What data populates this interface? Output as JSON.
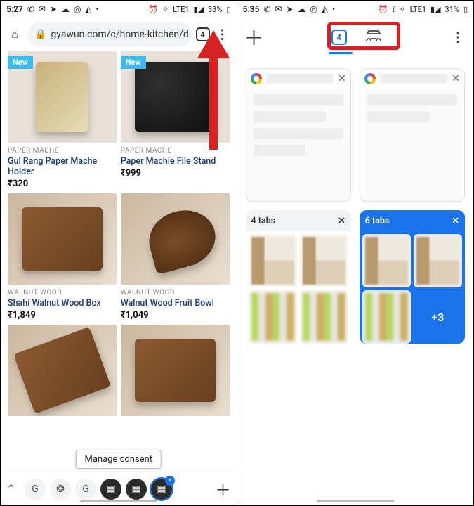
{
  "left": {
    "status": {
      "time": "5:27",
      "battery": "33%",
      "net": "LTE1"
    },
    "url": "gyawun.com/c/home-kitchen/d",
    "tab_count": "4",
    "new_label": "New",
    "products": [
      {
        "cat": "PAPER MACHE",
        "title": "Gul Rang Paper Mache Holder",
        "price": "₹320"
      },
      {
        "cat": "PAPER MACHE",
        "title": "Paper Machie File Stand",
        "price": "₹999"
      },
      {
        "cat": "WALNUT WOOD",
        "title": "Shahi Walnut Wood Box",
        "price": "₹1,849"
      },
      {
        "cat": "WALNUT WOOD",
        "title": "Walnut Wood Fruit Bowl",
        "price": "₹1,049"
      }
    ],
    "consent": "Manage consent"
  },
  "right": {
    "status": {
      "time": "5:35",
      "battery": "31%",
      "net": "LTE1"
    },
    "groups": [
      {
        "label": "4 tabs",
        "more": ""
      },
      {
        "label": "6 tabs",
        "more": "+3"
      }
    ]
  }
}
